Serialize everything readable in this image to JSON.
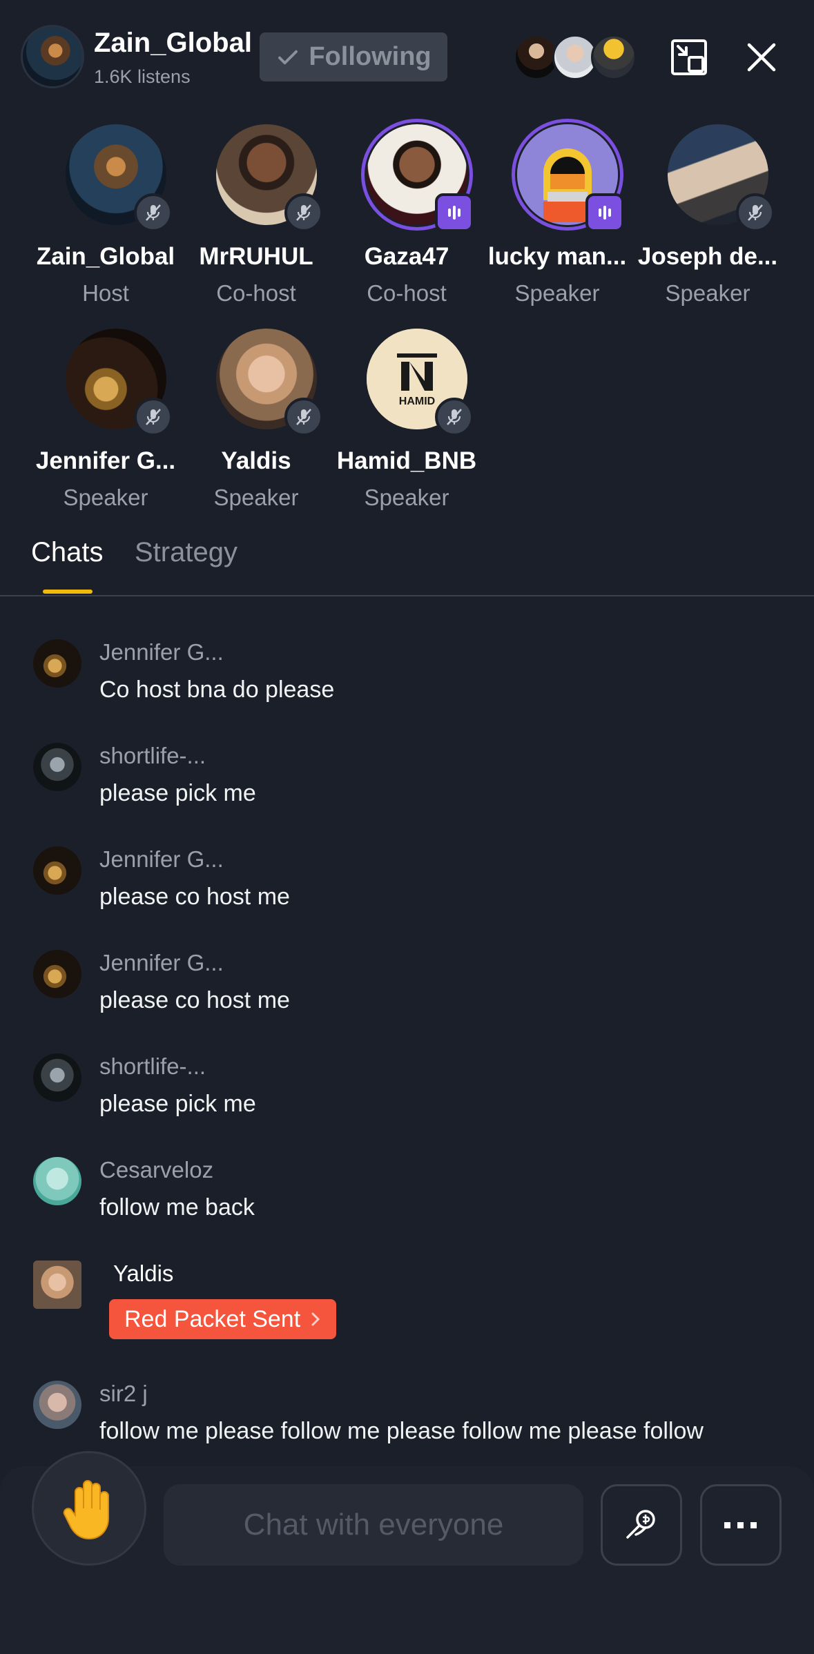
{
  "header": {
    "host_name": "Zain_Global",
    "listens": "1.6K listens",
    "follow_label": "Following"
  },
  "speakers": [
    {
      "name": "Zain_Global",
      "role": "Host",
      "mic": "muted"
    },
    {
      "name": "MrRUHUL",
      "role": "Co-host",
      "mic": "muted"
    },
    {
      "name": "Gaza47",
      "role": "Co-host",
      "mic": "speaking"
    },
    {
      "name": "lucky man...",
      "role": "Speaker",
      "mic": "speaking"
    },
    {
      "name": "Joseph de...",
      "role": "Speaker",
      "mic": "muted"
    },
    {
      "name": "Jennifer G...",
      "role": "Speaker",
      "mic": "muted"
    },
    {
      "name": "Yaldis",
      "role": "Speaker",
      "mic": "muted"
    },
    {
      "name": "Hamid_BNB",
      "role": "Speaker",
      "mic": "muted",
      "logo_text": "HAMID"
    }
  ],
  "tabs": [
    {
      "label": "Chats",
      "active": true
    },
    {
      "label": "Strategy",
      "active": false
    }
  ],
  "messages": [
    {
      "user": "Jennifer G...",
      "text": "Co host bna do please"
    },
    {
      "user": "shortlife-...",
      "text": "please pick me"
    },
    {
      "user": "Jennifer G...",
      "text": "please co host me"
    },
    {
      "user": "Jennifer G...",
      "text": "please co host me"
    },
    {
      "user": "shortlife-...",
      "text": "please pick me"
    },
    {
      "user": "Cesarveloz",
      "text": "follow me back"
    },
    {
      "user": "Yaldis",
      "red_packet": "Red Packet Sent"
    },
    {
      "user": "sir2 j",
      "text": "follow me please follow me please follow me please follow"
    }
  ],
  "composer": {
    "placeholder": "Chat with everyone"
  },
  "colors": {
    "background": "#1b1f29",
    "accent_purple": "#7b4fe0",
    "tab_indicator": "#f0b90b",
    "red_packet": "#f5553d"
  }
}
